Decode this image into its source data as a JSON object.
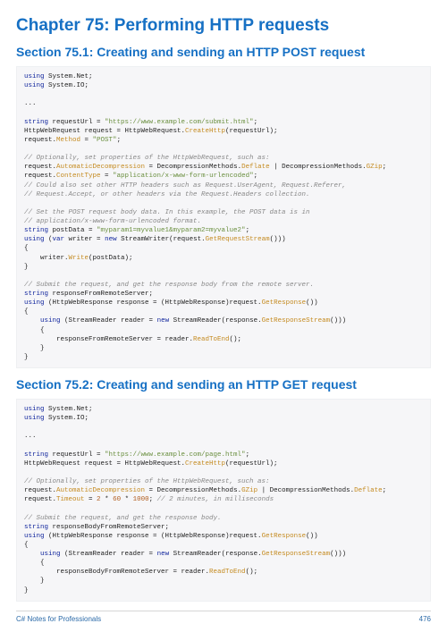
{
  "chapter_title": "Chapter 75: Performing HTTP requests",
  "section1_title": "Section 75.1: Creating and sending an HTTP POST request",
  "section2_title": "Section 75.2: Creating and sending an HTTP GET request",
  "footer_left": "C# Notes for Professionals",
  "footer_right": "476",
  "code1": {
    "l01a": "using",
    "l01b": " System.Net;",
    "l02a": "using",
    "l02b": " System.IO;",
    "ell": "...",
    "l03a": "string",
    "l03b": " requestUrl = ",
    "l03s": "\"https://www.example.com/submit.html\"",
    "l03c": ";",
    "l04a": "HttpWebRequest request = HttpWebRequest.",
    "l04m": "CreateHttp",
    "l04b": "(requestUrl);",
    "l05a": "request.",
    "l05m": "Method",
    "l05b": " = ",
    "l05s": "\"POST\"",
    "l05c": ";",
    "c1": "// Optionally, set properties of the HttpWebRequest, such as:",
    "l06a": "request.",
    "l06m": "AutomaticDecompression",
    "l06b": " = DecompressionMethods.",
    "l06m2": "Deflate",
    "l06c": " | DecompressionMethods.",
    "l06m3": "GZip",
    "l06d": ";",
    "l07a": "request.",
    "l07m": "ContentType",
    "l07b": " = ",
    "l07s": "\"application/x-www-form-urlencoded\"",
    "l07c": ";",
    "c2": "// Could also set other HTTP headers such as Request.UserAgent, Request.Referer,",
    "c3": "// Request.Accept, or other headers via the Request.Headers collection.",
    "c4": "// Set the POST request body data. In this example, the POST data is in",
    "c5": "// application/x-www-form-urlencoded format.",
    "l08a": "string",
    "l08b": " postData = ",
    "l08s": "\"myparam1=myvalue1&myparam2=myvalue2\"",
    "l08c": ";",
    "l09a": "using",
    "l09b": " (",
    "l09c": "var",
    "l09d": " writer = ",
    "l09e": "new",
    "l09f": " StreamWriter(request.",
    "l09m": "GetRequestStream",
    "l09g": "()))",
    "ob": "{",
    "l10a": "    writer.",
    "l10m": "Write",
    "l10b": "(postData);",
    "cb": "}",
    "c6": "// Submit the request, and get the response body from the remote server.",
    "l11a": "string",
    "l11b": " responseFromRemoteServer;",
    "l12a": "using",
    "l12b": " (HttpWebResponse response = (HttpWebResponse)request.",
    "l12m": "GetResponse",
    "l12c": "())",
    "l13a": "    ",
    "l13b": "using",
    "l13c": " (StreamReader reader = ",
    "l13d": "new",
    "l13e": " StreamReader(response.",
    "l13m": "GetResponseStream",
    "l13f": "()))",
    "l13ob": "    {",
    "l14a": "        responseFromRemoteServer = reader.",
    "l14m": "ReadToEnd",
    "l14b": "();",
    "l14cb": "    }"
  },
  "code2": {
    "l01a": "using",
    "l01b": " System.Net;",
    "l02a": "using",
    "l02b": " System.IO;",
    "ell": "...",
    "l03a": "string",
    "l03b": " requestUrl = ",
    "l03s": "\"https://www.example.com/page.html\"",
    "l03c": ";",
    "l04a": "HttpWebRequest request = HttpWebRequest.",
    "l04m": "CreateHttp",
    "l04b": "(requestUrl);",
    "c1": "// Optionally, set properties of the HttpWebRequest, such as:",
    "l05a": "request.",
    "l05m": "AutomaticDecompression",
    "l05b": " = DecompressionMethods.",
    "l05m2": "GZip",
    "l05c": " | DecompressionMethods.",
    "l05m3": "Deflate",
    "l05d": ";",
    "l06a": "request.",
    "l06m": "Timeout",
    "l06b": " = ",
    "l06n1": "2",
    "l06c": " * ",
    "l06n2": "60",
    "l06d": " * ",
    "l06n3": "1000",
    "l06e": "; ",
    "l06cm": "// 2 minutes, in milliseconds",
    "c2": "// Submit the request, and get the response body.",
    "l07a": "string",
    "l07b": " responseBodyFromRemoteServer;",
    "l08a": "using",
    "l08b": " (HttpWebResponse response = (HttpWebResponse)request.",
    "l08m": "GetResponse",
    "l08c": "())",
    "ob": "{",
    "l09a": "    ",
    "l09b": "using",
    "l09c": " (StreamReader reader = ",
    "l09d": "new",
    "l09e": " StreamReader(response.",
    "l09m": "GetResponseStream",
    "l09f": "()))",
    "l09ob": "    {",
    "l10a": "        responseBodyFromRemoteServer = reader.",
    "l10m": "ReadToEnd",
    "l10b": "();",
    "l10cb": "    }",
    "cb": "}"
  }
}
